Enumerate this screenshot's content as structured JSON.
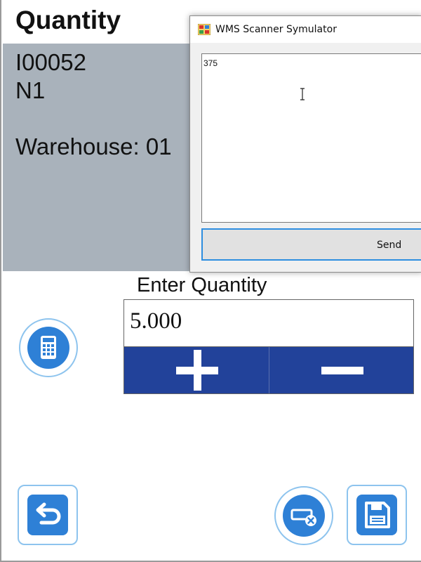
{
  "app": {
    "title": "Quantity",
    "info": {
      "item_code": "I00052",
      "variant": "N1",
      "warehouse": "Warehouse: 01"
    },
    "quantity": {
      "label": "Enter Quantity",
      "value": "5.000"
    },
    "icons": {
      "calculator": "calculator-icon",
      "back": "back-arrow-icon",
      "clear": "clear-keyboard-icon",
      "save": "floppy-save-icon",
      "plus": "plus-icon",
      "minus": "minus-icon"
    },
    "colors": {
      "info_panel": "#a9b2bb",
      "stepper": "#22429a",
      "icon_blue": "#2e80d6",
      "icon_ring": "#8ec4ee"
    }
  },
  "dialog": {
    "title": "WMS Scanner Symulator",
    "textarea_value": "375",
    "send_label": "Send",
    "accent": "#2e8ee0"
  }
}
